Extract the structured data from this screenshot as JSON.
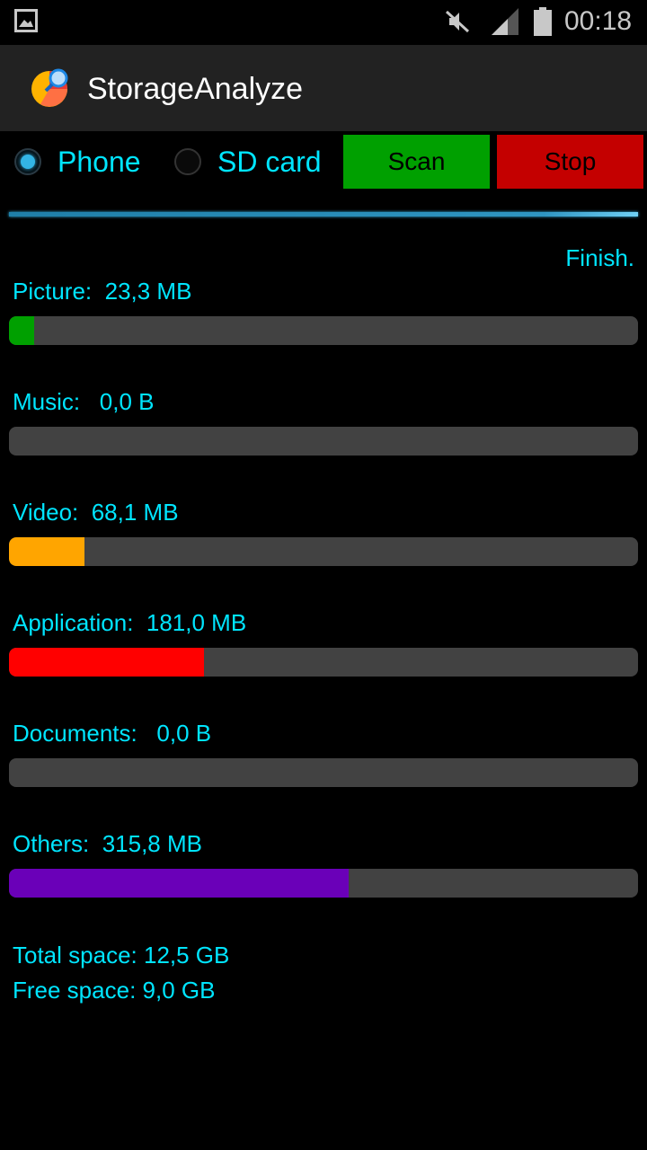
{
  "status_bar": {
    "time": "00:18",
    "icons": [
      "image-icon",
      "mute-icon",
      "signal-icon",
      "battery-icon"
    ]
  },
  "app_bar": {
    "title": "StorageAnalyze",
    "logo_icon": "pie-chart-magnifier-icon"
  },
  "storage_selector": {
    "options": [
      {
        "label": "Phone",
        "checked": true
      },
      {
        "label": "SD card",
        "checked": false
      }
    ]
  },
  "buttons": {
    "scan_label": "Scan",
    "stop_label": "Stop",
    "scan_color": "#00a000",
    "stop_color": "#c40000"
  },
  "scan_status": "Finish.",
  "categories": [
    {
      "name": "Picture:",
      "size": "23,3 MB",
      "fraction": 0.04,
      "color": "#00a000"
    },
    {
      "name": "Music:",
      "size": "0,0 B",
      "fraction": 0.0,
      "color": "#424242"
    },
    {
      "name": "Video:",
      "size": "68,1 MB",
      "fraction": 0.12,
      "color": "#ffa500"
    },
    {
      "name": "Application:",
      "size": "181,0 MB",
      "fraction": 0.31,
      "color": "#ff0000"
    },
    {
      "name": "Documents:",
      "size": "0,0 B",
      "fraction": 0.0,
      "color": "#424242"
    },
    {
      "name": "Others:",
      "size": "315,8 MB",
      "fraction": 0.54,
      "color": "#6a00b8"
    }
  ],
  "summary": {
    "total_space_label": "Total space:",
    "total_space_value": "12,5 GB",
    "free_space_label": "Free space:",
    "free_space_value": "9,0 GB"
  }
}
